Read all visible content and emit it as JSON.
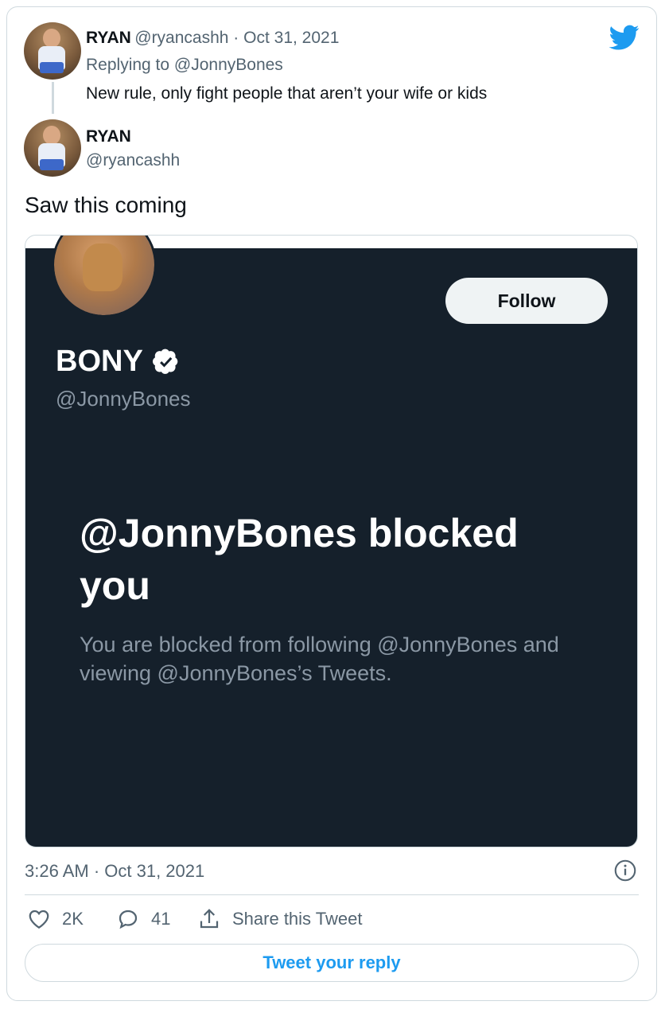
{
  "colors": {
    "twitter_blue": "#1d9bf0",
    "dark_bg": "#15202b",
    "muted": "#536471"
  },
  "reply_tweet": {
    "name": "RYAN",
    "handle": "@ryancashh",
    "date": "Oct 31, 2021",
    "separator": " · ",
    "replying_to": "Replying to @JonnyBones",
    "text": "New rule, only fight people that aren’t your wife or kids"
  },
  "main_tweet": {
    "name": "RYAN",
    "handle": "@ryancashh",
    "text": "Saw this coming",
    "timestamp": "3:26 AM · Oct 31, 2021",
    "likes": "2K",
    "replies": "41",
    "share_label": "Share this Tweet",
    "reply_prompt": "Tweet your reply"
  },
  "embedded_screenshot": {
    "display_name": "BONY",
    "handle": "@JonnyBones",
    "follow_label": "Follow",
    "blocked_title": "@JonnyBones blocked you",
    "blocked_description": "You are blocked from following @JonnyBones and viewing @JonnyBones’s Tweets."
  },
  "icons": [
    "twitter-bird-icon",
    "verified-badge-icon",
    "info-icon",
    "heart-icon",
    "reply-bubble-icon",
    "share-icon"
  ]
}
